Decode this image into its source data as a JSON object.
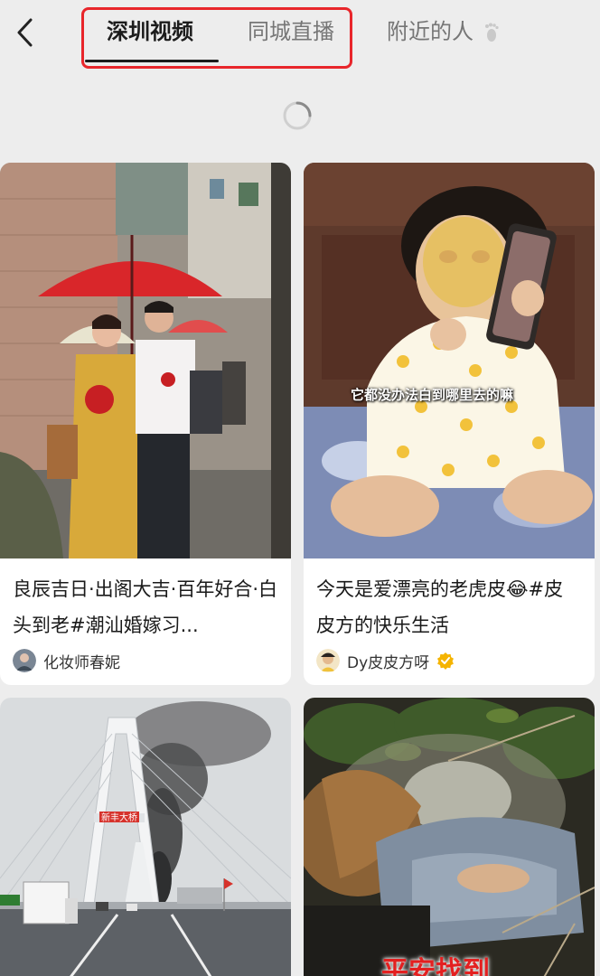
{
  "header": {
    "back_icon": "chevron-left-icon",
    "tabs": [
      {
        "label": "深圳视频",
        "active": true
      },
      {
        "label": "同城直播",
        "active": false
      },
      {
        "label": "附近的人",
        "active": false,
        "icon": "footprint-icon"
      }
    ],
    "highlight_color": "#e8262b"
  },
  "loading_indicator": "spinner-icon",
  "feed": [
    {
      "title": "良辰吉日·出阁大吉·百年好合·白头到老#潮汕婚嫁习...",
      "author": "化妆师春妮",
      "verified": false
    },
    {
      "title": "今天是爱漂亮的老虎皮😂#皮皮方的快乐生活",
      "author": "Dy皮皮方呀",
      "verified": true,
      "overlay_caption": "它都没办法白到哪里去的嘛"
    },
    {
      "sign_text": "新丰大桥"
    },
    {
      "overlay_caption": "平安找到"
    }
  ]
}
